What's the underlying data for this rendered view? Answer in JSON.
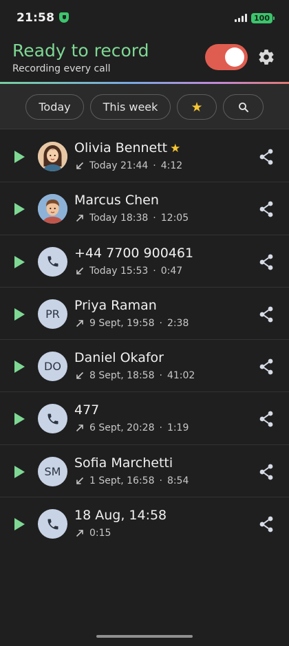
{
  "status_bar": {
    "time": "21:58",
    "battery": "100"
  },
  "header": {
    "title": "Ready to record",
    "subtitle": "Recording every call",
    "recording_enabled": true
  },
  "filters": {
    "today": "Today",
    "this_week": "This week",
    "starred_icon": "star-icon",
    "search_icon": "search-icon"
  },
  "calls": [
    {
      "name": "Olivia Bennett",
      "starred": true,
      "avatar": "photo-woman",
      "direction": "incoming",
      "when": "Today 21:44",
      "duration": "4:12"
    },
    {
      "name": "Marcus Chen",
      "starred": false,
      "avatar": "photo-man",
      "direction": "outgoing",
      "when": "Today 18:38",
      "duration": "12:05"
    },
    {
      "name": "+44 7700 900461",
      "starred": false,
      "avatar": "phone",
      "direction": "incoming",
      "when": "Today 15:53",
      "duration": "0:47"
    },
    {
      "name": "Priya Raman",
      "starred": false,
      "avatar": "PR",
      "direction": "outgoing",
      "when": "9 Sept, 19:58",
      "duration": "2:38"
    },
    {
      "name": "Daniel Okafor",
      "starred": false,
      "avatar": "DO",
      "direction": "incoming",
      "when": "8 Sept, 18:58",
      "duration": "41:02"
    },
    {
      "name": "477",
      "starred": false,
      "avatar": "phone",
      "direction": "outgoing",
      "when": "6 Sept, 20:28",
      "duration": "1:19"
    },
    {
      "name": "Sofia Marchetti",
      "starred": false,
      "avatar": "SM",
      "direction": "incoming",
      "when": "1 Sept, 16:58",
      "duration": "8:54"
    },
    {
      "name": "18 Aug, 14:58",
      "starred": false,
      "avatar": "phone",
      "direction": "outgoing",
      "when": "",
      "duration": "0:15"
    }
  ],
  "colors": {
    "accent_green": "#7ed894",
    "toggle_red": "#df5d50",
    "star": "#f5c533",
    "background": "#1f1f1f"
  }
}
